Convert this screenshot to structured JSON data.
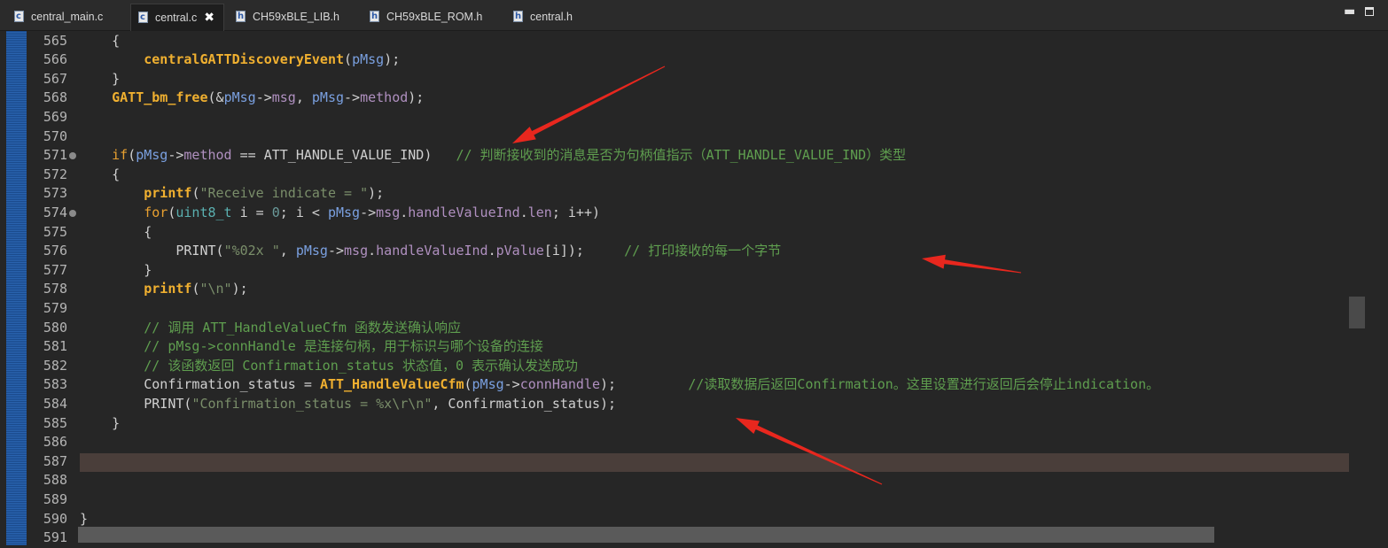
{
  "tabs": [
    {
      "label": "central_main.c",
      "type": "c",
      "active": false
    },
    {
      "label": "central.c",
      "type": "c",
      "active": true,
      "close": "✖"
    },
    {
      "label": "CH59xBLE_LIB.h",
      "type": "h",
      "active": false
    },
    {
      "label": "CH59xBLE_ROM.h",
      "type": "h",
      "active": false
    },
    {
      "label": "central.h",
      "type": "h",
      "active": false
    }
  ],
  "window_controls": {
    "minimize": "▬",
    "maximize_icon": "maximize-icon"
  },
  "colors": {
    "arrow": "#e8271e",
    "highlight_line": "#4a3e3a",
    "change_bar": "#1f4f92"
  },
  "editor": {
    "highlighted_line": "587",
    "lines": [
      {
        "n": "565",
        "segs": [
          [
            "plain",
            "    {"
          ]
        ]
      },
      {
        "n": "566",
        "segs": [
          [
            "plain",
            "        "
          ],
          [
            "fn",
            "centralGATTDiscoveryEvent"
          ],
          [
            "plain",
            "("
          ],
          [
            "var",
            "pMsg"
          ],
          [
            "plain",
            ");"
          ]
        ]
      },
      {
        "n": "567",
        "segs": [
          [
            "plain",
            "    }"
          ]
        ]
      },
      {
        "n": "568",
        "segs": [
          [
            "plain",
            "    "
          ],
          [
            "fn",
            "GATT_bm_free"
          ],
          [
            "plain",
            "(&"
          ],
          [
            "var",
            "pMsg"
          ],
          [
            "plain",
            "->"
          ],
          [
            "mem",
            "msg"
          ],
          [
            "plain",
            ", "
          ],
          [
            "var",
            "pMsg"
          ],
          [
            "plain",
            "->"
          ],
          [
            "mem",
            "method"
          ],
          [
            "plain",
            ");"
          ]
        ]
      },
      {
        "n": "569",
        "segs": []
      },
      {
        "n": "570",
        "segs": []
      },
      {
        "n": "571",
        "fold": true,
        "segs": [
          [
            "plain",
            "    "
          ],
          [
            "kw",
            "if"
          ],
          [
            "plain",
            "("
          ],
          [
            "var",
            "pMsg"
          ],
          [
            "plain",
            "->"
          ],
          [
            "mem",
            "method"
          ],
          [
            "plain",
            " == ATT_HANDLE_VALUE_IND)   "
          ],
          [
            "cmt",
            "// 判断接收到的消息是否为句柄值指示（ATT_HANDLE_VALUE_IND）类型"
          ]
        ]
      },
      {
        "n": "572",
        "segs": [
          [
            "plain",
            "    {"
          ]
        ]
      },
      {
        "n": "573",
        "segs": [
          [
            "plain",
            "        "
          ],
          [
            "fn",
            "printf"
          ],
          [
            "plain",
            "("
          ],
          [
            "str",
            "\"Receive indicate = \""
          ],
          [
            "plain",
            ");"
          ]
        ]
      },
      {
        "n": "574",
        "fold": true,
        "segs": [
          [
            "plain",
            "        "
          ],
          [
            "kw",
            "for"
          ],
          [
            "plain",
            "("
          ],
          [
            "typ",
            "uint8_t"
          ],
          [
            "plain",
            " i = "
          ],
          [
            "num",
            "0"
          ],
          [
            "plain",
            "; i < "
          ],
          [
            "var",
            "pMsg"
          ],
          [
            "plain",
            "->"
          ],
          [
            "mem",
            "msg"
          ],
          [
            "plain",
            "."
          ],
          [
            "mem",
            "handleValueInd"
          ],
          [
            "plain",
            "."
          ],
          [
            "mem",
            "len"
          ],
          [
            "plain",
            "; i++)"
          ]
        ]
      },
      {
        "n": "575",
        "segs": [
          [
            "plain",
            "        {"
          ]
        ]
      },
      {
        "n": "576",
        "segs": [
          [
            "plain",
            "            PRINT("
          ],
          [
            "str",
            "\"%02x \""
          ],
          [
            "plain",
            ", "
          ],
          [
            "var",
            "pMsg"
          ],
          [
            "plain",
            "->"
          ],
          [
            "mem",
            "msg"
          ],
          [
            "plain",
            "."
          ],
          [
            "mem",
            "handleValueInd"
          ],
          [
            "plain",
            "."
          ],
          [
            "mem",
            "pValue"
          ],
          [
            "plain",
            "[i]);     "
          ],
          [
            "cmt",
            "// 打印接收的每一个字节"
          ]
        ]
      },
      {
        "n": "577",
        "segs": [
          [
            "plain",
            "        }"
          ]
        ]
      },
      {
        "n": "578",
        "segs": [
          [
            "plain",
            "        "
          ],
          [
            "fn",
            "printf"
          ],
          [
            "plain",
            "("
          ],
          [
            "str",
            "\"\\n\""
          ],
          [
            "plain",
            ");"
          ]
        ]
      },
      {
        "n": "579",
        "segs": []
      },
      {
        "n": "580",
        "segs": [
          [
            "plain",
            "        "
          ],
          [
            "cmt",
            "// 调用 ATT_HandleValueCfm 函数发送确认响应"
          ]
        ]
      },
      {
        "n": "581",
        "segs": [
          [
            "plain",
            "        "
          ],
          [
            "cmt",
            "// pMsg->connHandle 是连接句柄，用于标识与哪个设备的连接"
          ]
        ]
      },
      {
        "n": "582",
        "segs": [
          [
            "plain",
            "        "
          ],
          [
            "cmt",
            "// 该函数返回 Confirmation_status 状态值，0 表示确认发送成功"
          ]
        ]
      },
      {
        "n": "583",
        "segs": [
          [
            "plain",
            "        Confirmation_status = "
          ],
          [
            "fn",
            "ATT_HandleValueCfm"
          ],
          [
            "plain",
            "("
          ],
          [
            "var",
            "pMsg"
          ],
          [
            "plain",
            "->"
          ],
          [
            "mem",
            "connHandle"
          ],
          [
            "plain",
            ");         "
          ],
          [
            "cmt",
            "//读取数据后返回Confirmation。这里设置进行返回后会停止indication。"
          ]
        ]
      },
      {
        "n": "584",
        "segs": [
          [
            "plain",
            "        PRINT("
          ],
          [
            "str",
            "\"Confirmation_status = %x\\r\\n\""
          ],
          [
            "plain",
            ", Confirmation_status);"
          ]
        ]
      },
      {
        "n": "585",
        "segs": [
          [
            "plain",
            "    }"
          ]
        ]
      },
      {
        "n": "586",
        "segs": []
      },
      {
        "n": "587",
        "segs": []
      },
      {
        "n": "588",
        "segs": []
      },
      {
        "n": "589",
        "segs": []
      },
      {
        "n": "590",
        "segs": [
          [
            "plain",
            "}"
          ]
        ]
      },
      {
        "n": "591",
        "segs": []
      }
    ]
  }
}
